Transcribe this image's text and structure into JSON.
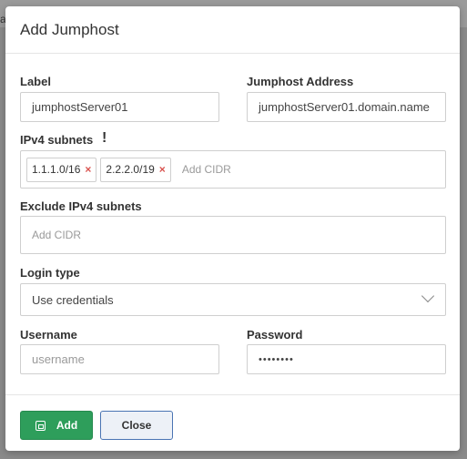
{
  "backdrop": {
    "char": "ac"
  },
  "modal": {
    "title": "Add Jumphost",
    "fields": {
      "label": {
        "label": "Label",
        "value": "jumphostServer01"
      },
      "address": {
        "label": "Jumphost Address",
        "value": "jumphostServer01.domain.name"
      },
      "ipv4": {
        "label": "IPv4 subnets",
        "warning_icon": "exclamation-icon",
        "tags": [
          "1.1.1.0/16",
          "2.2.2.0/19"
        ],
        "placeholder": "Add CIDR"
      },
      "exclude": {
        "label": "Exclude IPv4 subnets",
        "placeholder": "Add CIDR"
      },
      "login_type": {
        "label": "Login type",
        "value": "Use credentials"
      },
      "username": {
        "label": "Username",
        "placeholder": "username"
      },
      "password": {
        "label": "Password",
        "value": "••••••••"
      }
    },
    "footer": {
      "add_label": "Add",
      "close_label": "Close"
    }
  },
  "colors": {
    "primary": "#2e9e5b",
    "secondary_border": "#4a74b3",
    "danger": "#d9534f"
  }
}
